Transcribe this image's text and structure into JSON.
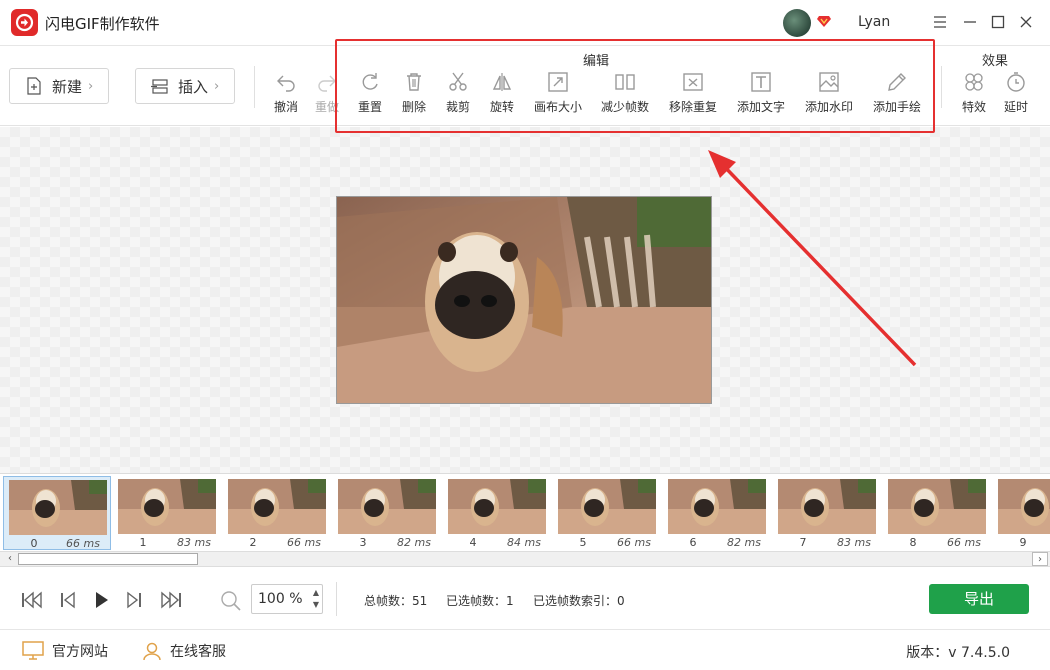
{
  "app": {
    "title": "闪电GIF制作软件",
    "username": "Lyan"
  },
  "toolbar": {
    "new_label": "新建",
    "insert_label": "插入",
    "undo_label": "撤消",
    "redo_label": "重做",
    "edit_group_label": "编辑",
    "effects_group_label": "效果",
    "edit_tools": [
      {
        "label": "重置",
        "icon": "reset-icon"
      },
      {
        "label": "删除",
        "icon": "trash-icon"
      },
      {
        "label": "裁剪",
        "icon": "scissors-icon"
      },
      {
        "label": "旋转",
        "icon": "flip-icon"
      },
      {
        "label": "画布大小",
        "icon": "resize-icon"
      },
      {
        "label": "减少帧数",
        "icon": "reduce-frames-icon"
      },
      {
        "label": "移除重复",
        "icon": "remove-duplicate-icon"
      },
      {
        "label": "添加文字",
        "icon": "text-icon"
      },
      {
        "label": "添加水印",
        "icon": "watermark-icon"
      },
      {
        "label": "添加手绘",
        "icon": "pencil-icon"
      }
    ],
    "effect_tools": [
      {
        "label": "特效",
        "icon": "effects-icon"
      },
      {
        "label": "延时",
        "icon": "timer-icon"
      }
    ]
  },
  "frames": [
    {
      "index": "0",
      "ms": "66 ms"
    },
    {
      "index": "1",
      "ms": "83 ms"
    },
    {
      "index": "2",
      "ms": "66 ms"
    },
    {
      "index": "3",
      "ms": "82 ms"
    },
    {
      "index": "4",
      "ms": "84 ms"
    },
    {
      "index": "5",
      "ms": "66 ms"
    },
    {
      "index": "6",
      "ms": "82 ms"
    },
    {
      "index": "7",
      "ms": "83 ms"
    },
    {
      "index": "8",
      "ms": "66 ms"
    },
    {
      "index": "9",
      "ms": ""
    }
  ],
  "selected_frame": 0,
  "playback": {
    "zoom_value": "100",
    "zoom_unit": "%",
    "total_frames_label": "总帧数：",
    "total_frames_value": "51",
    "selected_frames_label": "已选帧数：",
    "selected_frames_value": "1",
    "selected_index_label": "已选帧数索引：",
    "selected_index_value": "0",
    "export_label": "导出"
  },
  "footer": {
    "website_label": "官方网站",
    "support_label": "在线客服",
    "version_label": "版本：",
    "version_value": "v 7.4.5.0"
  },
  "colors": {
    "accent_red": "#e53030",
    "export_green": "#1fa14a",
    "brand_red": "#e02a2a"
  }
}
